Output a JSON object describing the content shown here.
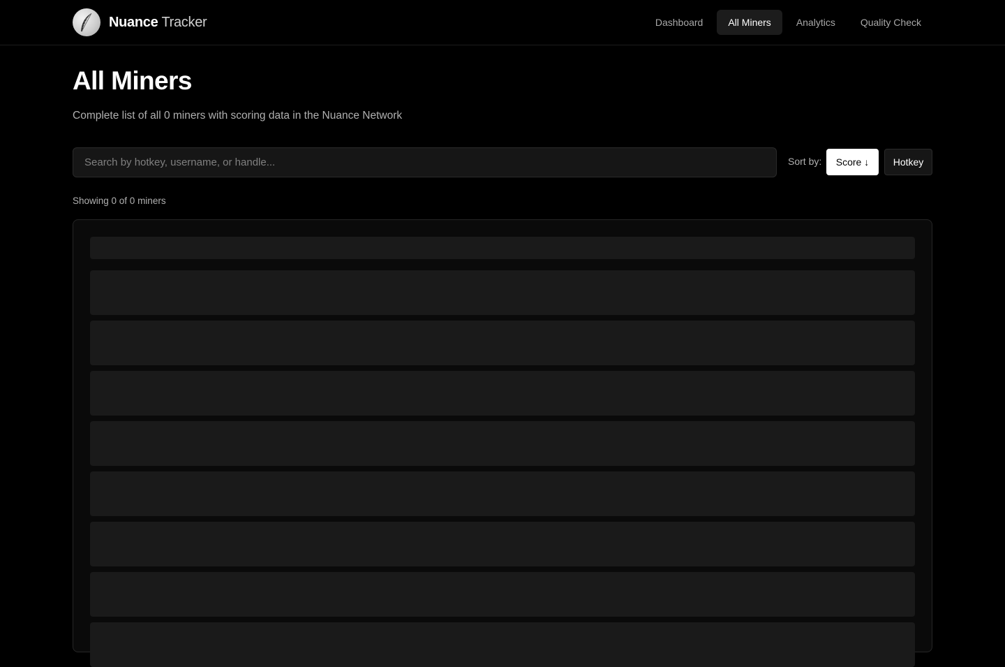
{
  "brand": {
    "name_strong": "Nuance",
    "name_light": "Tracker",
    "logo_icon": "feather-icon"
  },
  "nav": {
    "items": [
      {
        "label": "Dashboard",
        "active": false
      },
      {
        "label": "All Miners",
        "active": true
      },
      {
        "label": "Analytics",
        "active": false
      },
      {
        "label": "Quality Check",
        "active": false
      }
    ]
  },
  "page": {
    "title": "All Miners",
    "subtitle": "Complete list of all 0 miners with scoring data in the Nuance Network"
  },
  "search": {
    "placeholder": "Search by hotkey, username, or handle...",
    "value": ""
  },
  "sort": {
    "label": "Sort by:",
    "score_label": "Score ↓",
    "hotkey_label": "Hotkey",
    "active": "Score"
  },
  "results": {
    "showing_text": "Showing 0 of 0 miners"
  },
  "colors": {
    "background": "#000000",
    "panel": "#0a0a0a",
    "skeleton": "#1a1a1a",
    "active_nav": "#1c1c1c",
    "accent": "#ffffff"
  }
}
